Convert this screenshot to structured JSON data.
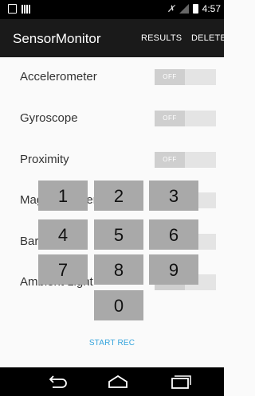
{
  "status_bar": {
    "time": "4:57",
    "icons": [
      "notification-box-icon",
      "barcode-icon",
      "nfc-icon",
      "signal-icon",
      "battery-icon"
    ]
  },
  "app_bar": {
    "title": "SensorMonitor",
    "actions": {
      "results": "RESULTS",
      "delete": "DELETE"
    }
  },
  "sensors": [
    {
      "label": "Accelerometer",
      "state": "OFF"
    },
    {
      "label": "Gyroscope",
      "state": "OFF"
    },
    {
      "label": "Proximity",
      "state": "OFF"
    },
    {
      "label": "Magnetometer",
      "state": "OFF"
    },
    {
      "label": "Barometer",
      "state": "OFF"
    },
    {
      "label": "Ambient Light",
      "state": "OFF"
    }
  ],
  "keypad": {
    "keys": [
      "1",
      "2",
      "3",
      "4",
      "5",
      "6",
      "7",
      "8",
      "9",
      "0"
    ]
  },
  "start_rec": "START REC",
  "nav": {
    "icons": [
      "back-icon",
      "home-icon",
      "recents-icon"
    ]
  },
  "colors": {
    "app_bar": "#1a1a1a",
    "accent": "#33a3dc",
    "key": "#a9a9a9",
    "background": "#fafafa"
  }
}
